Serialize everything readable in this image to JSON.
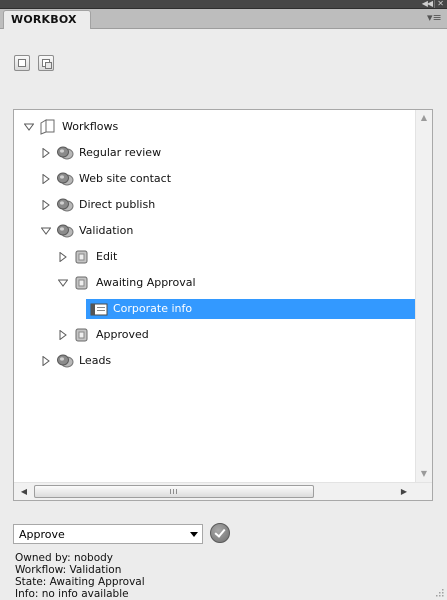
{
  "window": {
    "collapse_icon": "double-chevron-left-icon",
    "separator": "|",
    "close_icon": "close-icon"
  },
  "tab": {
    "title": "WORKBOX",
    "menu_icon": "panel-menu-icon"
  },
  "toolbar": {
    "items": [
      {
        "icon": "document-icon"
      },
      {
        "icon": "copy-icon"
      }
    ]
  },
  "tree": {
    "rows": [
      {
        "label": "Workflows",
        "level": 0,
        "expanded": true,
        "icon": "folder-icon",
        "selected": false
      },
      {
        "label": "Regular review",
        "level": 1,
        "expanded": false,
        "icon": "workflow-icon",
        "selected": false
      },
      {
        "label": "Web site contact",
        "level": 1,
        "expanded": false,
        "icon": "workflow-icon",
        "selected": false
      },
      {
        "label": "Direct publish",
        "level": 1,
        "expanded": false,
        "icon": "workflow-icon",
        "selected": false
      },
      {
        "label": "Validation",
        "level": 1,
        "expanded": true,
        "icon": "workflow-icon",
        "selected": false
      },
      {
        "label": "Edit",
        "level": 2,
        "expanded": false,
        "icon": "state-icon",
        "selected": false
      },
      {
        "label": "Awaiting Approval",
        "level": 2,
        "expanded": true,
        "icon": "state-icon",
        "selected": false
      },
      {
        "label": "Corporate info",
        "level": 3,
        "expanded": null,
        "icon": "item-icon",
        "selected": true
      },
      {
        "label": "Approved",
        "level": 2,
        "expanded": false,
        "icon": "state-icon",
        "selected": false
      },
      {
        "label": "Leads",
        "level": 1,
        "expanded": false,
        "icon": "workflow-icon",
        "selected": false
      }
    ]
  },
  "hscroll": {
    "grip": "III"
  },
  "action": {
    "selected": "Approve",
    "go_icon": "checkmark-icon"
  },
  "info": {
    "owned_by": "Owned by: nobody",
    "workflow": "Workflow: Validation",
    "state": "State: Awaiting Approval",
    "info": "Info: no info available"
  },
  "colors": {
    "selection": "#3399ff",
    "panel": "#ececec",
    "topbar": "#474747"
  }
}
